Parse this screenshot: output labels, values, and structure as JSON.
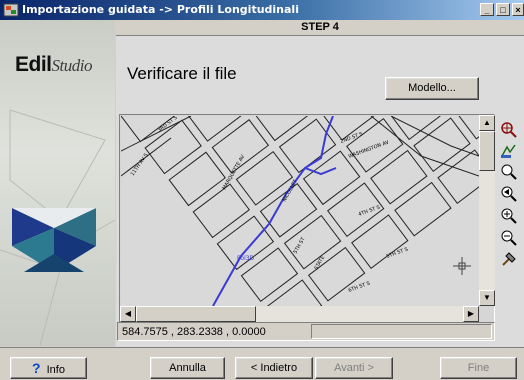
{
  "window": {
    "title": "Importazione guidata -> Profili Longitudinali",
    "controls": [
      "_",
      "□",
      "×"
    ]
  },
  "sidebar": {
    "logo_bold": "Edil",
    "logo_script": "Studio"
  },
  "header": {
    "step": "STEP 4"
  },
  "main": {
    "heading": "Verificare il file",
    "model_button": "Modello..."
  },
  "map": {
    "poly_label": "Pol3D",
    "street_labels": [
      "3RD ST S",
      "WASHINGTON AV",
      "2ND ST S",
      "11TH AV S",
      "MARQUETTE AV",
      "NICOLLET",
      "4TH ST S",
      "5TH ST S",
      "STATE",
      "6TH ST S",
      "5TH ST"
    ],
    "accent_color": "#3b3bd4"
  },
  "status": {
    "coordinates": "584.7575 , 283.2338 , 0.0000"
  },
  "tools": [
    "zoom-window-icon",
    "pan-icon",
    "zoom-extents-icon",
    "zoom-previous-icon",
    "zoom-in-icon",
    "zoom-out-icon",
    "settings-tool-icon"
  ],
  "footer": {
    "info": "Info",
    "cancel": "Annulla",
    "back": "< Indietro",
    "next": "Avanti >",
    "finish": "Fine"
  }
}
